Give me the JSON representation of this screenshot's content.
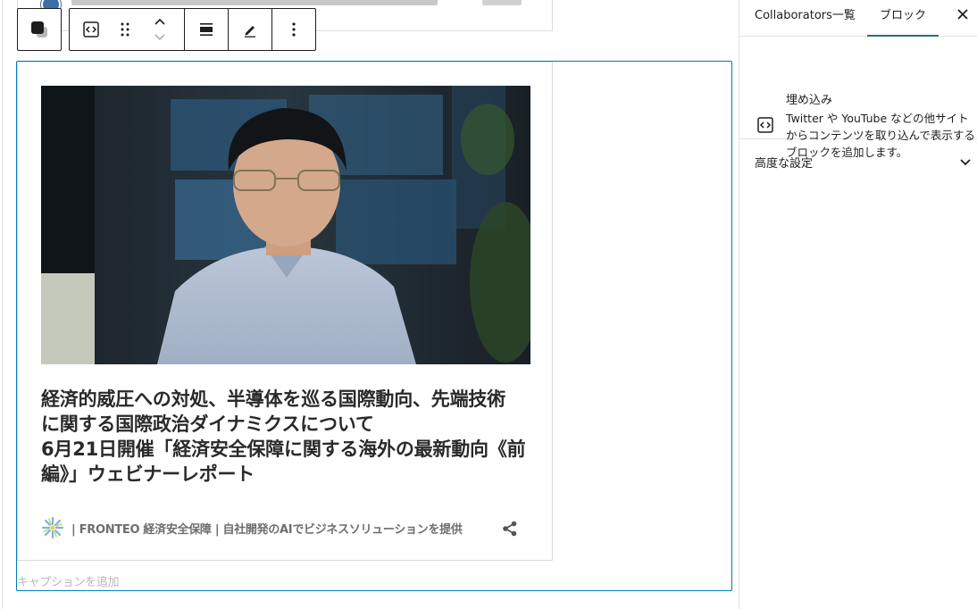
{
  "sidebar": {
    "tabs": [
      {
        "label": "Collaborators一覧"
      },
      {
        "label": "ブロック"
      }
    ],
    "close_icon": "close-icon",
    "block": {
      "name": "埋め込み",
      "description": "Twitter や YouTube などの他サイトからコンテンツを取り込んで表示するブロックを追加します。",
      "icon": "embed-icon"
    },
    "advanced": {
      "label": "高度な設定",
      "icon": "chevron-down-icon"
    }
  },
  "toolbar": {
    "items": [
      "block-switcher",
      "embed-type",
      "drag-handle",
      "move-up",
      "move-down",
      "align",
      "edit",
      "more-options"
    ]
  },
  "embed": {
    "title": "経済的威圧への対処、半導体を巡る国際動向、先端技術\nに関する国際政治ダイナミクスについて\n6月21日開催「経済安全保障に関する海外の最新動向《前\n編》」ウェビナーレポート",
    "site_name": "| FRONTEO 経済安全保障 | 自社開発のAIでビジネスソリューションを提供",
    "caption_placeholder": "キャプションを追加"
  },
  "colors": {
    "accent": "#007cba",
    "tab_underline": "#2c6e84"
  }
}
